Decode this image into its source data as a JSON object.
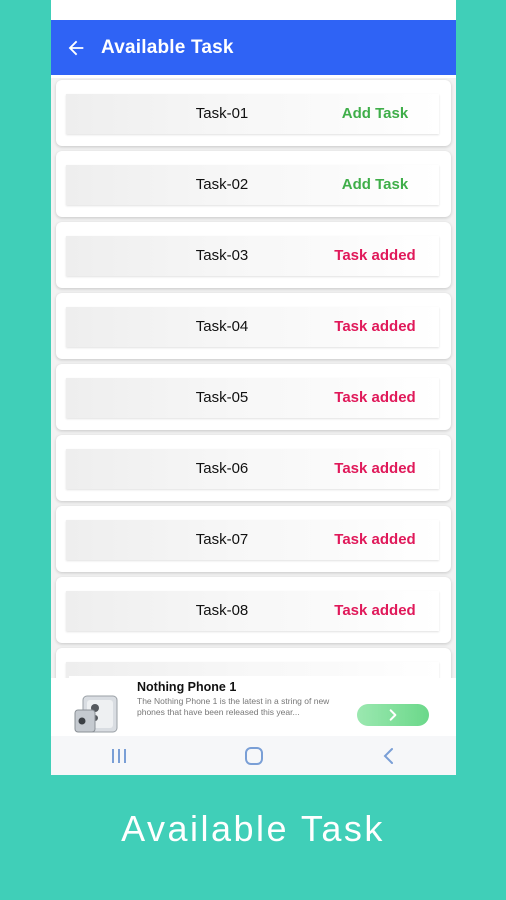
{
  "app": {
    "title": "Available Task"
  },
  "tasks": [
    {
      "name": "Task-01",
      "status": "Add Task",
      "state": "add"
    },
    {
      "name": "Task-02",
      "status": "Add Task",
      "state": "add"
    },
    {
      "name": "Task-03",
      "status": "Task added",
      "state": "added"
    },
    {
      "name": "Task-04",
      "status": "Task added",
      "state": "added"
    },
    {
      "name": "Task-05",
      "status": "Task added",
      "state": "added"
    },
    {
      "name": "Task-06",
      "status": "Task added",
      "state": "added"
    },
    {
      "name": "Task-07",
      "status": "Task added",
      "state": "added"
    },
    {
      "name": "Task-08",
      "status": "Task added",
      "state": "added"
    }
  ],
  "ad": {
    "title": "Nothing Phone 1",
    "description": "The Nothing Phone 1 is the latest in a string of new phones that have been released this year...",
    "button_icon": "chevron-right-icon"
  },
  "navbar": {
    "icons": [
      "recent-apps-icon",
      "home-icon",
      "back-icon"
    ]
  },
  "caption": "Available Task",
  "colors": {
    "background": "#40cfb8",
    "appbar": "#2f63f5",
    "add_status": "#3fae49",
    "added_status": "#e0195a"
  }
}
